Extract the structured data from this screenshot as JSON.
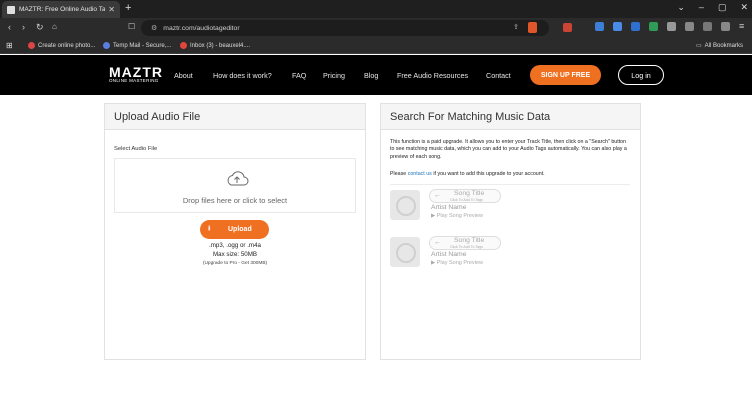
{
  "browser": {
    "tab_title": "MAZTR: Free Online Audio Tag E",
    "url": "maztr.com/audiotageditor",
    "bookmarks": [
      "Create online photo...",
      "Temp Mail - Secure,...",
      "Inbox (3) - beauxel4...."
    ],
    "all_bookmarks": "All Bookmarks"
  },
  "site": {
    "logo": "MAZTR",
    "logo_sub": "ONLINE MASTERING",
    "nav": [
      "About",
      "How does it work?",
      "FAQ",
      "Pricing",
      "Blog",
      "Free Audio Resources",
      "Contact"
    ],
    "signup": "SIGN UP FREE",
    "login": "Log in"
  },
  "upload": {
    "title": "Upload Audio File",
    "label": "Select Audio File",
    "drop_text": "Drop files here or click to select",
    "button": "Upload",
    "formats": ".mp3, .ogg or .m4a",
    "max_size": "Max size: 50MB",
    "upgrade": "(Upgrade to Pro - Get 300MB)"
  },
  "search": {
    "title": "Search For Matching Music Data",
    "description": "This function is a paid upgrade. It allows you to enter your Track Title, then click on a \"Search\" button to see matching music data, which you can add to your Audio Tags automatically. You can also play a preview of each song.",
    "please_prefix": "Please",
    "contact_link": "contact us",
    "please_suffix": "if you want to add this upgrade to your account.",
    "results": [
      {
        "song_title": "Song Title",
        "click_hint": "Click To Add To Tags",
        "artist": "Artist Name",
        "preview": "Play Song Preview"
      },
      {
        "song_title": "Song Title",
        "click_hint": "Click To Add To Tags",
        "artist": "Artist Name",
        "preview": "Play Song Preview"
      }
    ]
  },
  "colors": {
    "accent": "#f07021",
    "link": "#1a73b8",
    "nav_bg": "#000000"
  }
}
